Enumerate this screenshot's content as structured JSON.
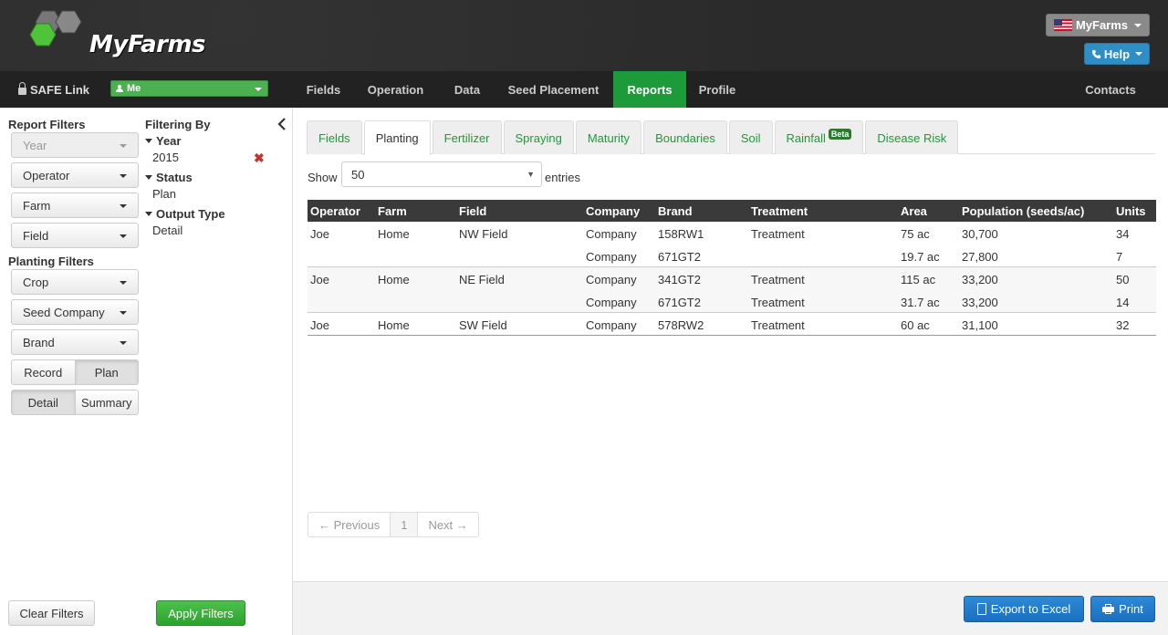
{
  "header": {
    "brand": "MyFarms",
    "account_button": "MyFarms",
    "help_button": "Help"
  },
  "nav": {
    "safe_link": "SAFE Link",
    "user_select": "Me",
    "items": [
      "Fields",
      "Operation",
      "Data",
      "Seed Placement",
      "Reports",
      "Profile"
    ],
    "active": "Reports",
    "contacts": "Contacts",
    "active_color": "#1d9a3a"
  },
  "sidebar": {
    "report_filters_title": "Report Filters",
    "report_filters": [
      "Year",
      "Operator",
      "Farm",
      "Field"
    ],
    "planting_filters_title": "Planting Filters",
    "planting_filters": [
      "Crop",
      "Seed Company",
      "Brand"
    ],
    "record_plan": {
      "left": "Record",
      "right": "Plan",
      "selected": "Plan"
    },
    "detail_summary": {
      "left": "Detail",
      "right": "Summary",
      "selected": "Detail"
    },
    "filtering_by_title": "Filtering By",
    "filtering_by": [
      {
        "label": "Year",
        "value": "2015"
      },
      {
        "label": "Status",
        "value": "Plan"
      },
      {
        "label": "Output Type",
        "value": "Detail"
      }
    ],
    "clear_filters": "Clear Filters",
    "apply_filters": "Apply Filters"
  },
  "tabs": {
    "items": [
      "Fields",
      "Planting",
      "Fertilizer",
      "Spraying",
      "Maturity",
      "Boundaries",
      "Soil",
      "Rainfall",
      "Disease Risk"
    ],
    "active": "Planting",
    "beta_badge": "Beta",
    "link_color": "#1e9a38"
  },
  "table_controls": {
    "show_label": "Show",
    "page_size": "50",
    "entries_label": "entries"
  },
  "table": {
    "headers": [
      "Operator",
      "Farm",
      "Field",
      "Company",
      "Brand",
      "Treatment",
      "Area",
      "Population (seeds/ac)",
      "Units"
    ],
    "groups": [
      {
        "rows": [
          {
            "operator": "Joe",
            "farm": "Home",
            "field": "NW Field",
            "company": "Company",
            "brand": "158RW1",
            "treatment": "Treatment",
            "area": "75 ac",
            "population": "30,700",
            "units": "34"
          },
          {
            "operator": "",
            "farm": "",
            "field": "",
            "company": "Company",
            "brand": "671GT2",
            "treatment": "",
            "area": "19.7 ac",
            "population": "27,800",
            "units": "7"
          }
        ]
      },
      {
        "rows": [
          {
            "operator": "Joe",
            "farm": "Home",
            "field": "NE Field",
            "company": "Company",
            "brand": "341GT2",
            "treatment": "Treatment",
            "area": "115 ac",
            "population": "33,200",
            "units": "50"
          },
          {
            "operator": "",
            "farm": "",
            "field": "",
            "company": "Company",
            "brand": "671GT2",
            "treatment": "Treatment",
            "area": "31.7 ac",
            "population": "33,200",
            "units": "14"
          }
        ]
      },
      {
        "rows": [
          {
            "operator": "Joe",
            "farm": "Home",
            "field": "SW Field",
            "company": "Company",
            "brand": "578RW2",
            "treatment": "Treatment",
            "area": "60 ac",
            "population": "31,100",
            "units": "32"
          }
        ]
      }
    ]
  },
  "pagination": {
    "previous": "← Previous",
    "current": "1",
    "next": "Next →"
  },
  "footer": {
    "export_button": "Export to Excel",
    "print_button": "Print"
  }
}
